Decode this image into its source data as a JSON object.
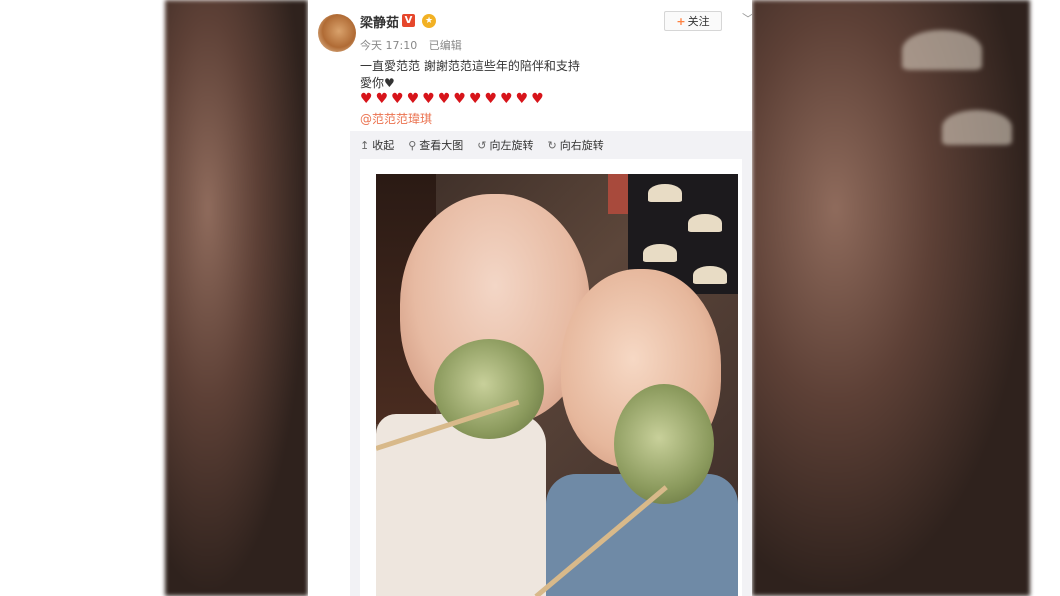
{
  "post": {
    "username": "梁静茹",
    "verified_badge": "V",
    "medal_icon": "medal-icon",
    "follow_label": "关注",
    "time": "今天 17:10",
    "edited": "已编辑",
    "line1": "一直愛范范 謝謝范范這些年的陪伴和支持",
    "line2": "愛你♥",
    "hearts": [
      "♥",
      "♥",
      "♥",
      "♥",
      "♥",
      "♥",
      "♥",
      "♥",
      "♥",
      "♥",
      "♥",
      "♥"
    ],
    "mention": "@范范范瑋琪"
  },
  "toolbar": {
    "collapse": "收起",
    "view_large": "查看大图",
    "rotate_left": "向左旋转",
    "rotate_right": "向右旋转"
  },
  "colors": {
    "mention": "#eb7350",
    "heart": "#d7141a",
    "follow_plus": "#ff8140",
    "vbadge": "#e6472c"
  }
}
